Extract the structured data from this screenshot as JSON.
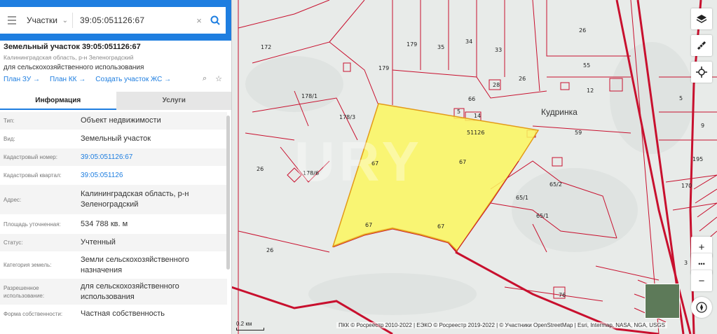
{
  "search": {
    "layer": "Участки",
    "value": "39:05:051126:67"
  },
  "card": {
    "title": "Земельный участок 39:05:051126:67",
    "subtitle": "Калининградская область, р-н Зеленоградский",
    "purpose": "для сельскохозяйственного использования",
    "links": [
      "План ЗУ →",
      "План КК →",
      "Создать участок ЖС →"
    ]
  },
  "tabs": [
    "Информация",
    "Услуги"
  ],
  "info": [
    {
      "k": "Тип:",
      "v": "Объект недвижимости"
    },
    {
      "k": "Вид:",
      "v": "Земельный участок"
    },
    {
      "k": "Кадастровый номер:",
      "v": "39:05:051126:67"
    },
    {
      "k": "Кадастровый квартал:",
      "v": "39:05:051126"
    },
    {
      "k": "Адрес:",
      "v": "Калининградская область, р-н Зеленоградский"
    },
    {
      "k": "Площадь уточненная:",
      "v": "534 788 кв. м"
    },
    {
      "k": "Статус:",
      "v": "Учтенный"
    },
    {
      "k": "Категория земель:",
      "v": "Земли сельскохозяйственного назначения"
    },
    {
      "k": "Разрешенное использование:",
      "v": "для сельскохозяйственного использования"
    },
    {
      "k": "Форма собственности:",
      "v": "Частная собственность"
    }
  ],
  "map": {
    "place": "Кудринка",
    "quarter_label": "51126",
    "watermark": "URY",
    "parcel_labels": [
      "172",
      "179",
      "35",
      "34",
      "33",
      "26",
      "179",
      "55",
      "28",
      "26",
      "66",
      "12",
      "5",
      "178/1",
      "178/3",
      "5",
      "14",
      "59",
      "9",
      "26",
      "67",
      "67",
      "178/6",
      "195",
      "65/2",
      "65/1",
      "65/1",
      "67",
      "67",
      "26",
      "3",
      "76",
      "170"
    ],
    "scale": "0.2 км",
    "attribution": "ПКК © Росреестр 2010-2022 | ЕЭКО © Росреестр 2019-2022 | © Участники OpenStreetMap | Esri, Intermap, NASA, NGA, USGS"
  },
  "controls": {
    "layers": "layers-icon",
    "ruler": "ruler-icon",
    "locate": "crosshair-icon",
    "zoom_in": "+",
    "more": "•••",
    "zoom_out": "−",
    "compass": "compass-icon"
  },
  "colors": {
    "accent": "#1e7ee0",
    "parcel_border": "#c8102e",
    "selected_fill": "#fbf75e",
    "selected_border": "#e39a17"
  }
}
